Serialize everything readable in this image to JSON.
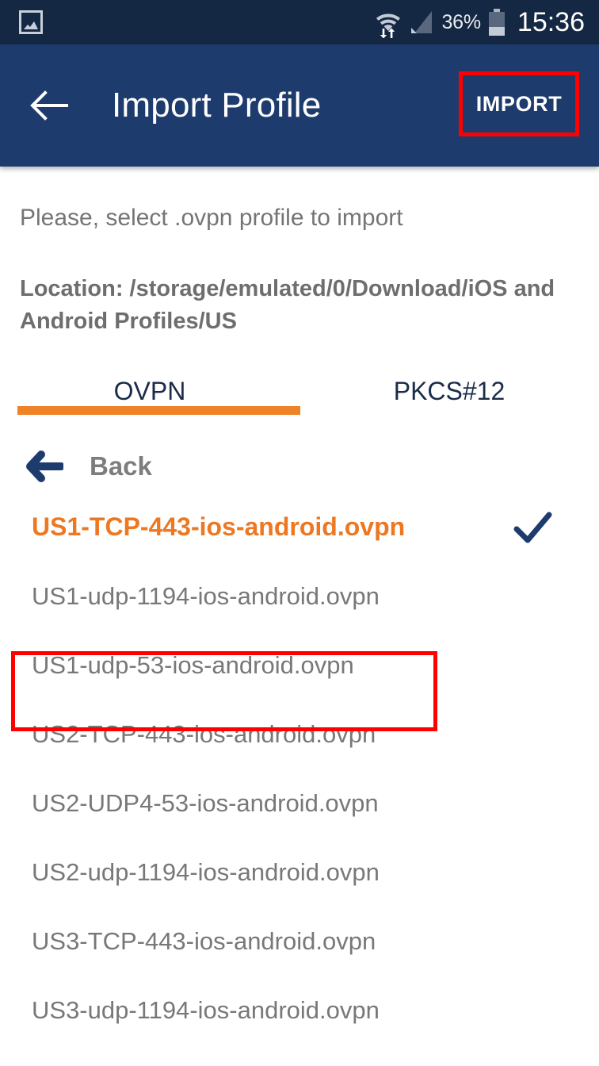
{
  "status_bar": {
    "notification_icon": "gallery-icon",
    "wifi_icon": "wifi-icon",
    "signal_icon": "cellular-signal-icon",
    "battery_percent": "36%",
    "battery_icon": "battery-icon",
    "time": "15:36",
    "background_color": "#152843"
  },
  "app_bar": {
    "back_icon": "arrow-left-icon",
    "title": "Import Profile",
    "action_label": "IMPORT",
    "background_color": "#1e3b6e",
    "highlight_color": "#ff0000"
  },
  "main": {
    "hint": "Please, select .ovpn profile to import",
    "location": "Location: /storage/emulated/0/Download/iOS and Android Profiles/US",
    "tabs": [
      {
        "label": "OVPN",
        "active": true
      },
      {
        "label": "PKCS#12",
        "active": false
      }
    ],
    "tab_indicator_color": "#ee8227",
    "back_row": {
      "icon": "arrow-left-icon",
      "label": "Back"
    },
    "files": [
      {
        "name": "US1-TCP-443-ios-android.ovpn",
        "selected": true,
        "check": true
      },
      {
        "name": "US1-udp-1194-ios-android.ovpn",
        "selected": false,
        "check": false
      },
      {
        "name": "US1-udp-53-ios-android.ovpn",
        "selected": false,
        "check": false
      },
      {
        "name": "US2-TCP-443-ios-android.ovpn",
        "selected": false,
        "check": false
      },
      {
        "name": "US2-UDP4-53-ios-android.ovpn",
        "selected": false,
        "check": false
      },
      {
        "name": "US2-udp-1194-ios-android.ovpn",
        "selected": false,
        "check": false
      },
      {
        "name": "US3-TCP-443-ios-android.ovpn",
        "selected": false,
        "check": false
      },
      {
        "name": "US3-udp-1194-ios-android.ovpn",
        "selected": false,
        "check": false
      }
    ],
    "selected_color": "#ee7722",
    "check_color": "#1e3b6e"
  }
}
